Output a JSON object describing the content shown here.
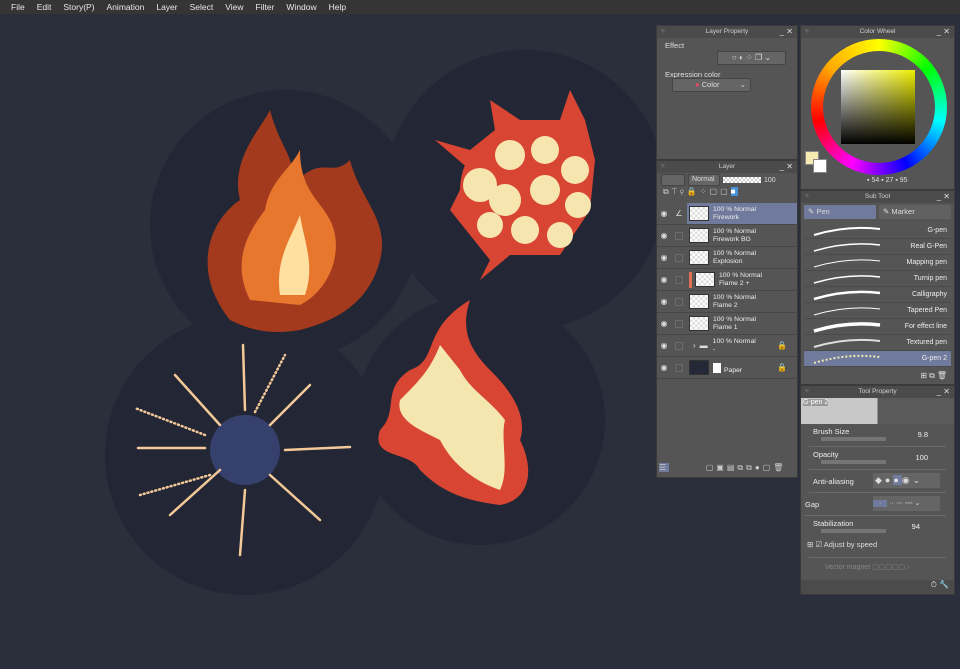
{
  "menu": [
    "File",
    "Edit",
    "Story(P)",
    "Animation",
    "Layer",
    "Select",
    "View",
    "Filter",
    "Window",
    "Help"
  ],
  "layer_property": {
    "title": "Layer Property",
    "effect_label": "Effect",
    "expression_label": "Expression color",
    "expression_value": "Color"
  },
  "layer_panel": {
    "title": "Layer",
    "blend_mode": "Normal",
    "opacity": "100",
    "layers": [
      {
        "line1": "100 % Normal",
        "line2": "Firework"
      },
      {
        "line1": "100 % Normal",
        "line2": "Firework BG"
      },
      {
        "line1": "100 % Normal",
        "line2": "Explosion"
      },
      {
        "line1": "100 % Normal",
        "line2": "Flame 2 +"
      },
      {
        "line1": "100 % Normal",
        "line2": "Flame 2"
      },
      {
        "line1": "100 % Normal",
        "line2": "Flame 1"
      },
      {
        "line1": "100 % Normal",
        "line2": "-"
      },
      {
        "line1": "",
        "line2": "Paper"
      }
    ]
  },
  "color_wheel": {
    "title": "Color Wheel",
    "h": "54",
    "s": "27",
    "v": "95",
    "main_color": "#f5eab0",
    "sub_color": "#ffffff"
  },
  "sub_tool": {
    "title": "Sub Tool",
    "tabs": [
      "Pen",
      "Marker"
    ],
    "brushes": [
      "G-pen",
      "Real G-Pen",
      "Mapping pen",
      "Turnip pen",
      "Calligraphy",
      "Tapered Pen",
      "For effect line",
      "Textured pen",
      "G-pen 2"
    ]
  },
  "tool_property": {
    "title": "Tool Property",
    "brush_name": "G-pen 2",
    "brush_size_label": "Brush Size",
    "brush_size": "9.8",
    "opacity_label": "Opacity",
    "opacity": "100",
    "antialias_label": "Anti-aliasing",
    "gap_label": "Gap",
    "stabilization_label": "Stabilization",
    "stabilization": "94",
    "adjust_speed_label": "Adjust by speed",
    "vector_magnet_label": "Vector magnet"
  }
}
